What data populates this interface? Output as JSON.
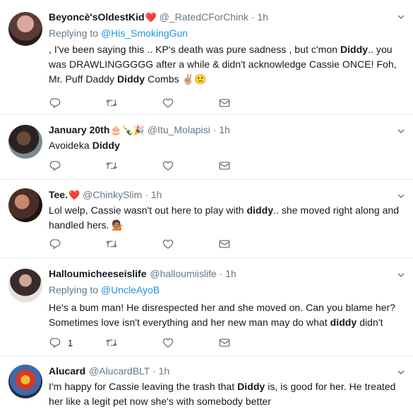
{
  "tweets": [
    {
      "name": "Beyoncè'sOldestKid",
      "name_emoji": "❤️",
      "handle": "@_RatedCForChink",
      "dot": "·",
      "time": "1h",
      "replying_prefix": "Replying to",
      "replying_to": "@His_SmokingGun",
      "text_parts": [
        ", I've been saying this .. KP's death was pure sadness , but c'mon ",
        "Diddy",
        ".. you was DRAWLINGGGGG after a while & didn't acknowledge Cassie ONCE! Foh, Mr. Puff Daddy ",
        "Diddy",
        " Combs ✌🏼🙁"
      ],
      "reply_count": ""
    },
    {
      "name": "January 20th",
      "name_emoji": "🎂🍾🎉",
      "handle": "@Itu_Molapisi",
      "dot": "·",
      "time": "1h",
      "text_parts": [
        "Avoideka ",
        "Diddy",
        ""
      ],
      "reply_count": ""
    },
    {
      "name": "Tee.",
      "name_emoji": "❤️",
      "handle": "@ChinkySlim",
      "dot": "·",
      "time": "1h",
      "text_parts": [
        "Lol welp, Cassie wasn't out here to play with ",
        "diddy",
        ".. she moved right along and handled hers. 💁🏽"
      ],
      "reply_count": ""
    },
    {
      "name": "Halloumicheeseislife",
      "name_emoji": "",
      "handle": "@halloumiislife",
      "dot": "·",
      "time": "1h",
      "replying_prefix": "Replying to",
      "replying_to": "@UncleAyoB",
      "text_parts": [
        "He's a bum man! He disrespected her and she moved on. Can you blame her? Sometimes love isn't everything and her new man may do what ",
        "diddy",
        " didn't"
      ],
      "reply_count": "1"
    },
    {
      "name": "Alucard",
      "name_emoji": "",
      "handle": "@AlucardBLT",
      "dot": "·",
      "time": "1h",
      "text_parts": [
        "I'm happy for Cassie leaving the trash that ",
        "Diddy",
        " is, is good for her. He treated her like a legit pet now she's with somebody better"
      ],
      "reply_count": ""
    }
  ],
  "icons": [
    "reply-icon",
    "retweet-icon",
    "like-icon",
    "direct-message-icon",
    "caret-down-icon"
  ],
  "colors": {
    "text": "#14171a",
    "secondary": "#657786",
    "link": "#1b95e0",
    "divider": "#e6ecf0",
    "heart": "#e0245e"
  }
}
